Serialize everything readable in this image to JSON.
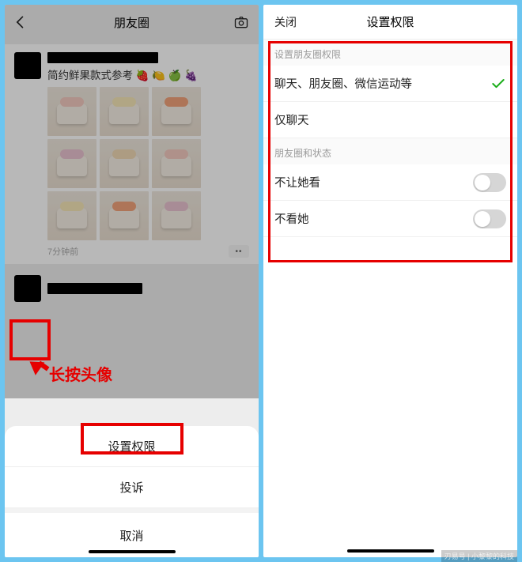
{
  "left": {
    "header_title": "朋友圈",
    "post1": {
      "caption": "简约鲜果款式参考 🍓 🍋 🍏 🍇",
      "time": "7分钟前"
    },
    "annotation": "长按头像",
    "sheet": {
      "item1": "设置权限",
      "item2": "投诉",
      "cancel": "取消"
    }
  },
  "right": {
    "close": "关闭",
    "title": "设置权限",
    "section1": "设置朋友圈权限",
    "opt1": "聊天、朋友圈、微信运动等",
    "opt2": "仅聊天",
    "section2": "朋友圈和状态",
    "toggle1": "不让她看",
    "toggle2": "不看她"
  },
  "watermark": "刃易号 | 小黎黎的科技"
}
